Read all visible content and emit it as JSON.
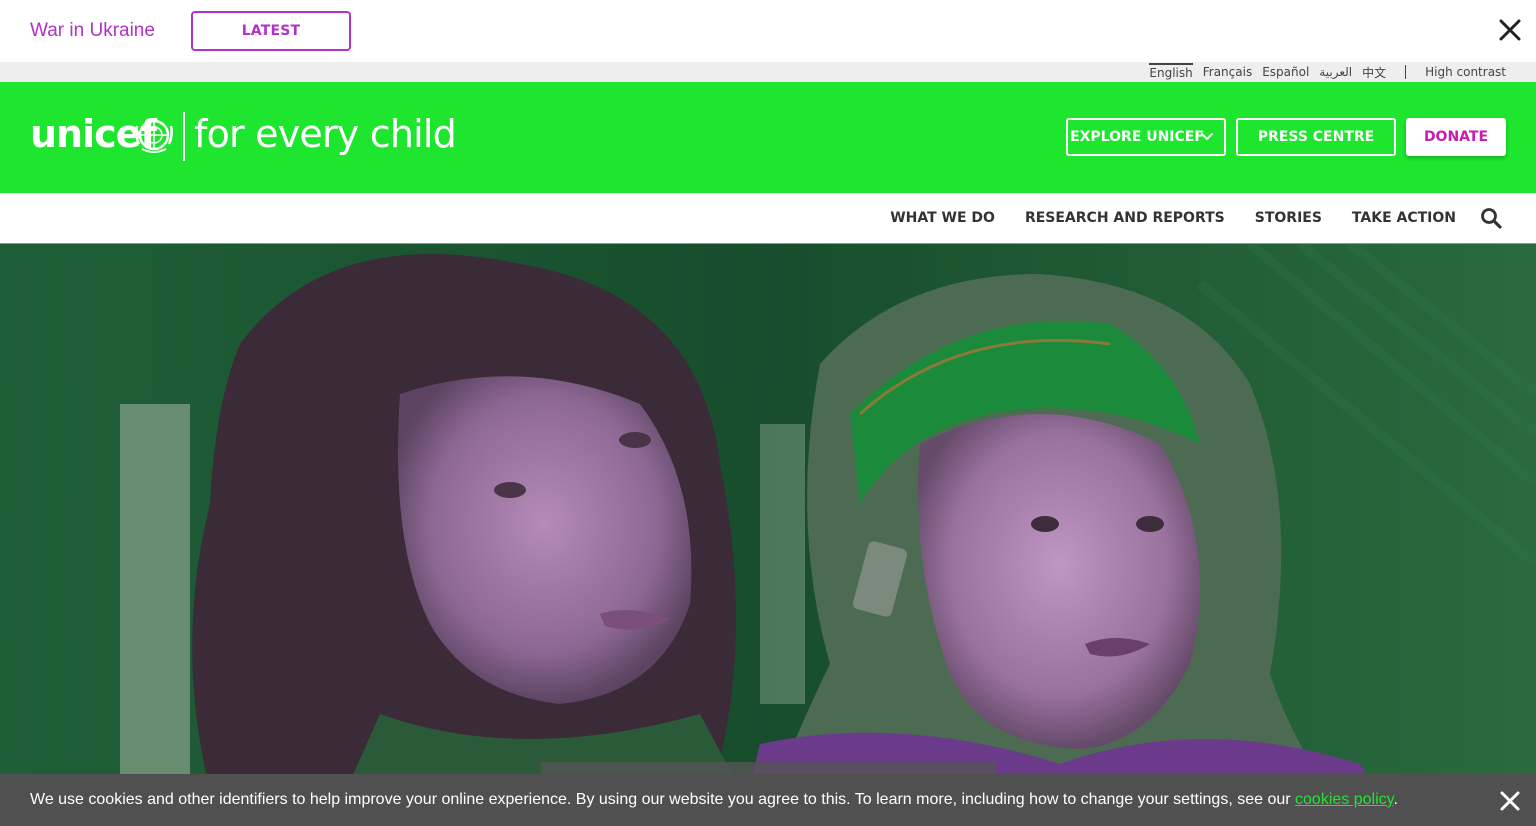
{
  "alert": {
    "title": "War in Ukraine",
    "button_label": "LATEST",
    "close_icon": "close-icon"
  },
  "languages": {
    "items": [
      "English",
      "Français",
      "Español",
      "العربية",
      "中文"
    ],
    "active": "English",
    "high_contrast": "High contrast"
  },
  "header": {
    "logo_text": "unicef",
    "tagline": "for every child",
    "explore_label": "EXPLORE UNICEF",
    "press_label": "PRESS CENTRE",
    "donate_label": "DONATE",
    "brand_color": "#1ee62f",
    "accent_color": "#c71db3"
  },
  "nav": {
    "items": [
      "WHAT WE DO",
      "RESEARCH AND REPORTS",
      "STORIES",
      "TAKE ACTION"
    ],
    "search_icon": "search-icon"
  },
  "cookie": {
    "text": "We use cookies and other identifiers to help improve your online experience. By using our website you agree to this. To learn more, including how to change your settings, see our ",
    "link": "cookies policy",
    "after": "."
  }
}
